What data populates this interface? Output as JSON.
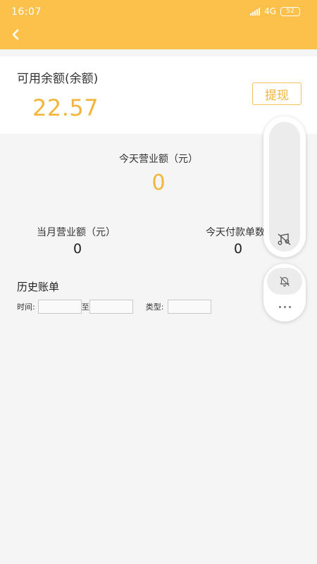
{
  "status_bar": {
    "time": "16:07",
    "network": "4G",
    "battery": "52"
  },
  "header": {
    "back_icon": "chevron-left-icon",
    "color": "#fbc14a"
  },
  "balance": {
    "title": "可用余额(余额)",
    "value": "22.57",
    "withdraw_label": "提现",
    "accent_color": "#f4b63a"
  },
  "stats": {
    "today_revenue_label": "今天营业额（元）",
    "today_revenue_value": "0",
    "month_revenue_label": "当月营业额（元）",
    "month_revenue_value": "0",
    "today_payments_label": "今天付款单数",
    "today_payments_value": "0"
  },
  "history": {
    "title": "历史账单",
    "time_label": "时间:",
    "to_label": "至",
    "type_label": "类型:",
    "start_date_value": "",
    "end_date_value": "",
    "type_value": ""
  },
  "floating_toolbar": {
    "music_icon": "music-note-slash-icon",
    "bell_icon": "bell-slash-icon",
    "more_icon": "more-dots-icon"
  }
}
